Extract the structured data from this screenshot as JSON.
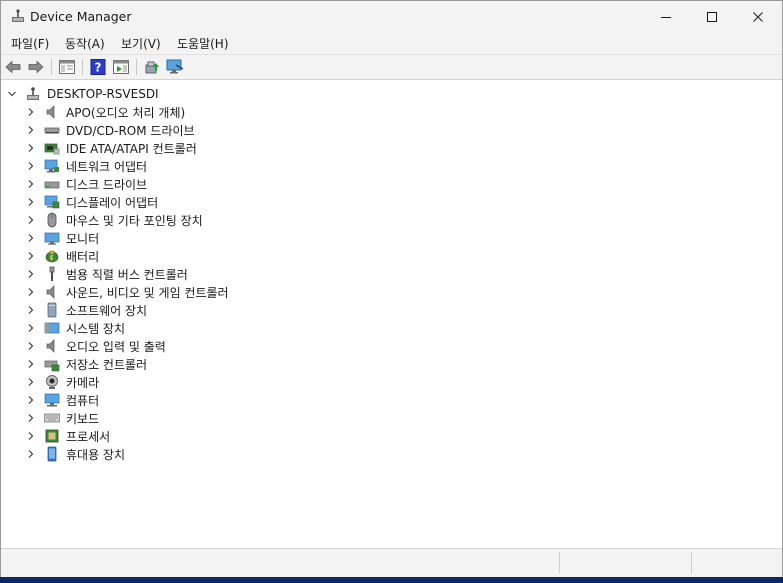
{
  "window": {
    "title": "Device Manager"
  },
  "menu": [
    "파일(F)",
    "동작(A)",
    "보기(V)",
    "도움말(H)"
  ],
  "tree": {
    "root": "DESKTOP-RSVESDI",
    "items": [
      {
        "label": "APO(오디오 처리 개체)",
        "icon": "speaker-icon"
      },
      {
        "label": "DVD/CD-ROM 드라이브",
        "icon": "optical-drive-icon"
      },
      {
        "label": "IDE ATA/ATAPI 컨트롤러",
        "icon": "controller-card-icon"
      },
      {
        "label": "네트워크 어댑터",
        "icon": "network-adapter-icon"
      },
      {
        "label": "디스크 드라이브",
        "icon": "disk-drive-icon"
      },
      {
        "label": "디스플레이 어댑터",
        "icon": "display-adapter-icon"
      },
      {
        "label": "마우스 및 기타 포인팅 장치",
        "icon": "mouse-icon"
      },
      {
        "label": "모니터",
        "icon": "monitor-icon"
      },
      {
        "label": "배터리",
        "icon": "battery-icon"
      },
      {
        "label": "범용 직렬 버스 컨트롤러",
        "icon": "usb-icon"
      },
      {
        "label": "사운드, 비디오 및 게임 컨트롤러",
        "icon": "speaker-icon"
      },
      {
        "label": "소프트웨어 장치",
        "icon": "software-device-icon"
      },
      {
        "label": "시스템 장치",
        "icon": "system-device-icon"
      },
      {
        "label": "오디오 입력 및 출력",
        "icon": "speaker-icon"
      },
      {
        "label": "저장소 컨트롤러",
        "icon": "storage-controller-icon"
      },
      {
        "label": "카메라",
        "icon": "camera-icon"
      },
      {
        "label": "컴퓨터",
        "icon": "computer-icon"
      },
      {
        "label": "키보드",
        "icon": "keyboard-icon"
      },
      {
        "label": "프로세서",
        "icon": "processor-icon"
      },
      {
        "label": "휴대용 장치",
        "icon": "portable-device-icon"
      }
    ]
  }
}
